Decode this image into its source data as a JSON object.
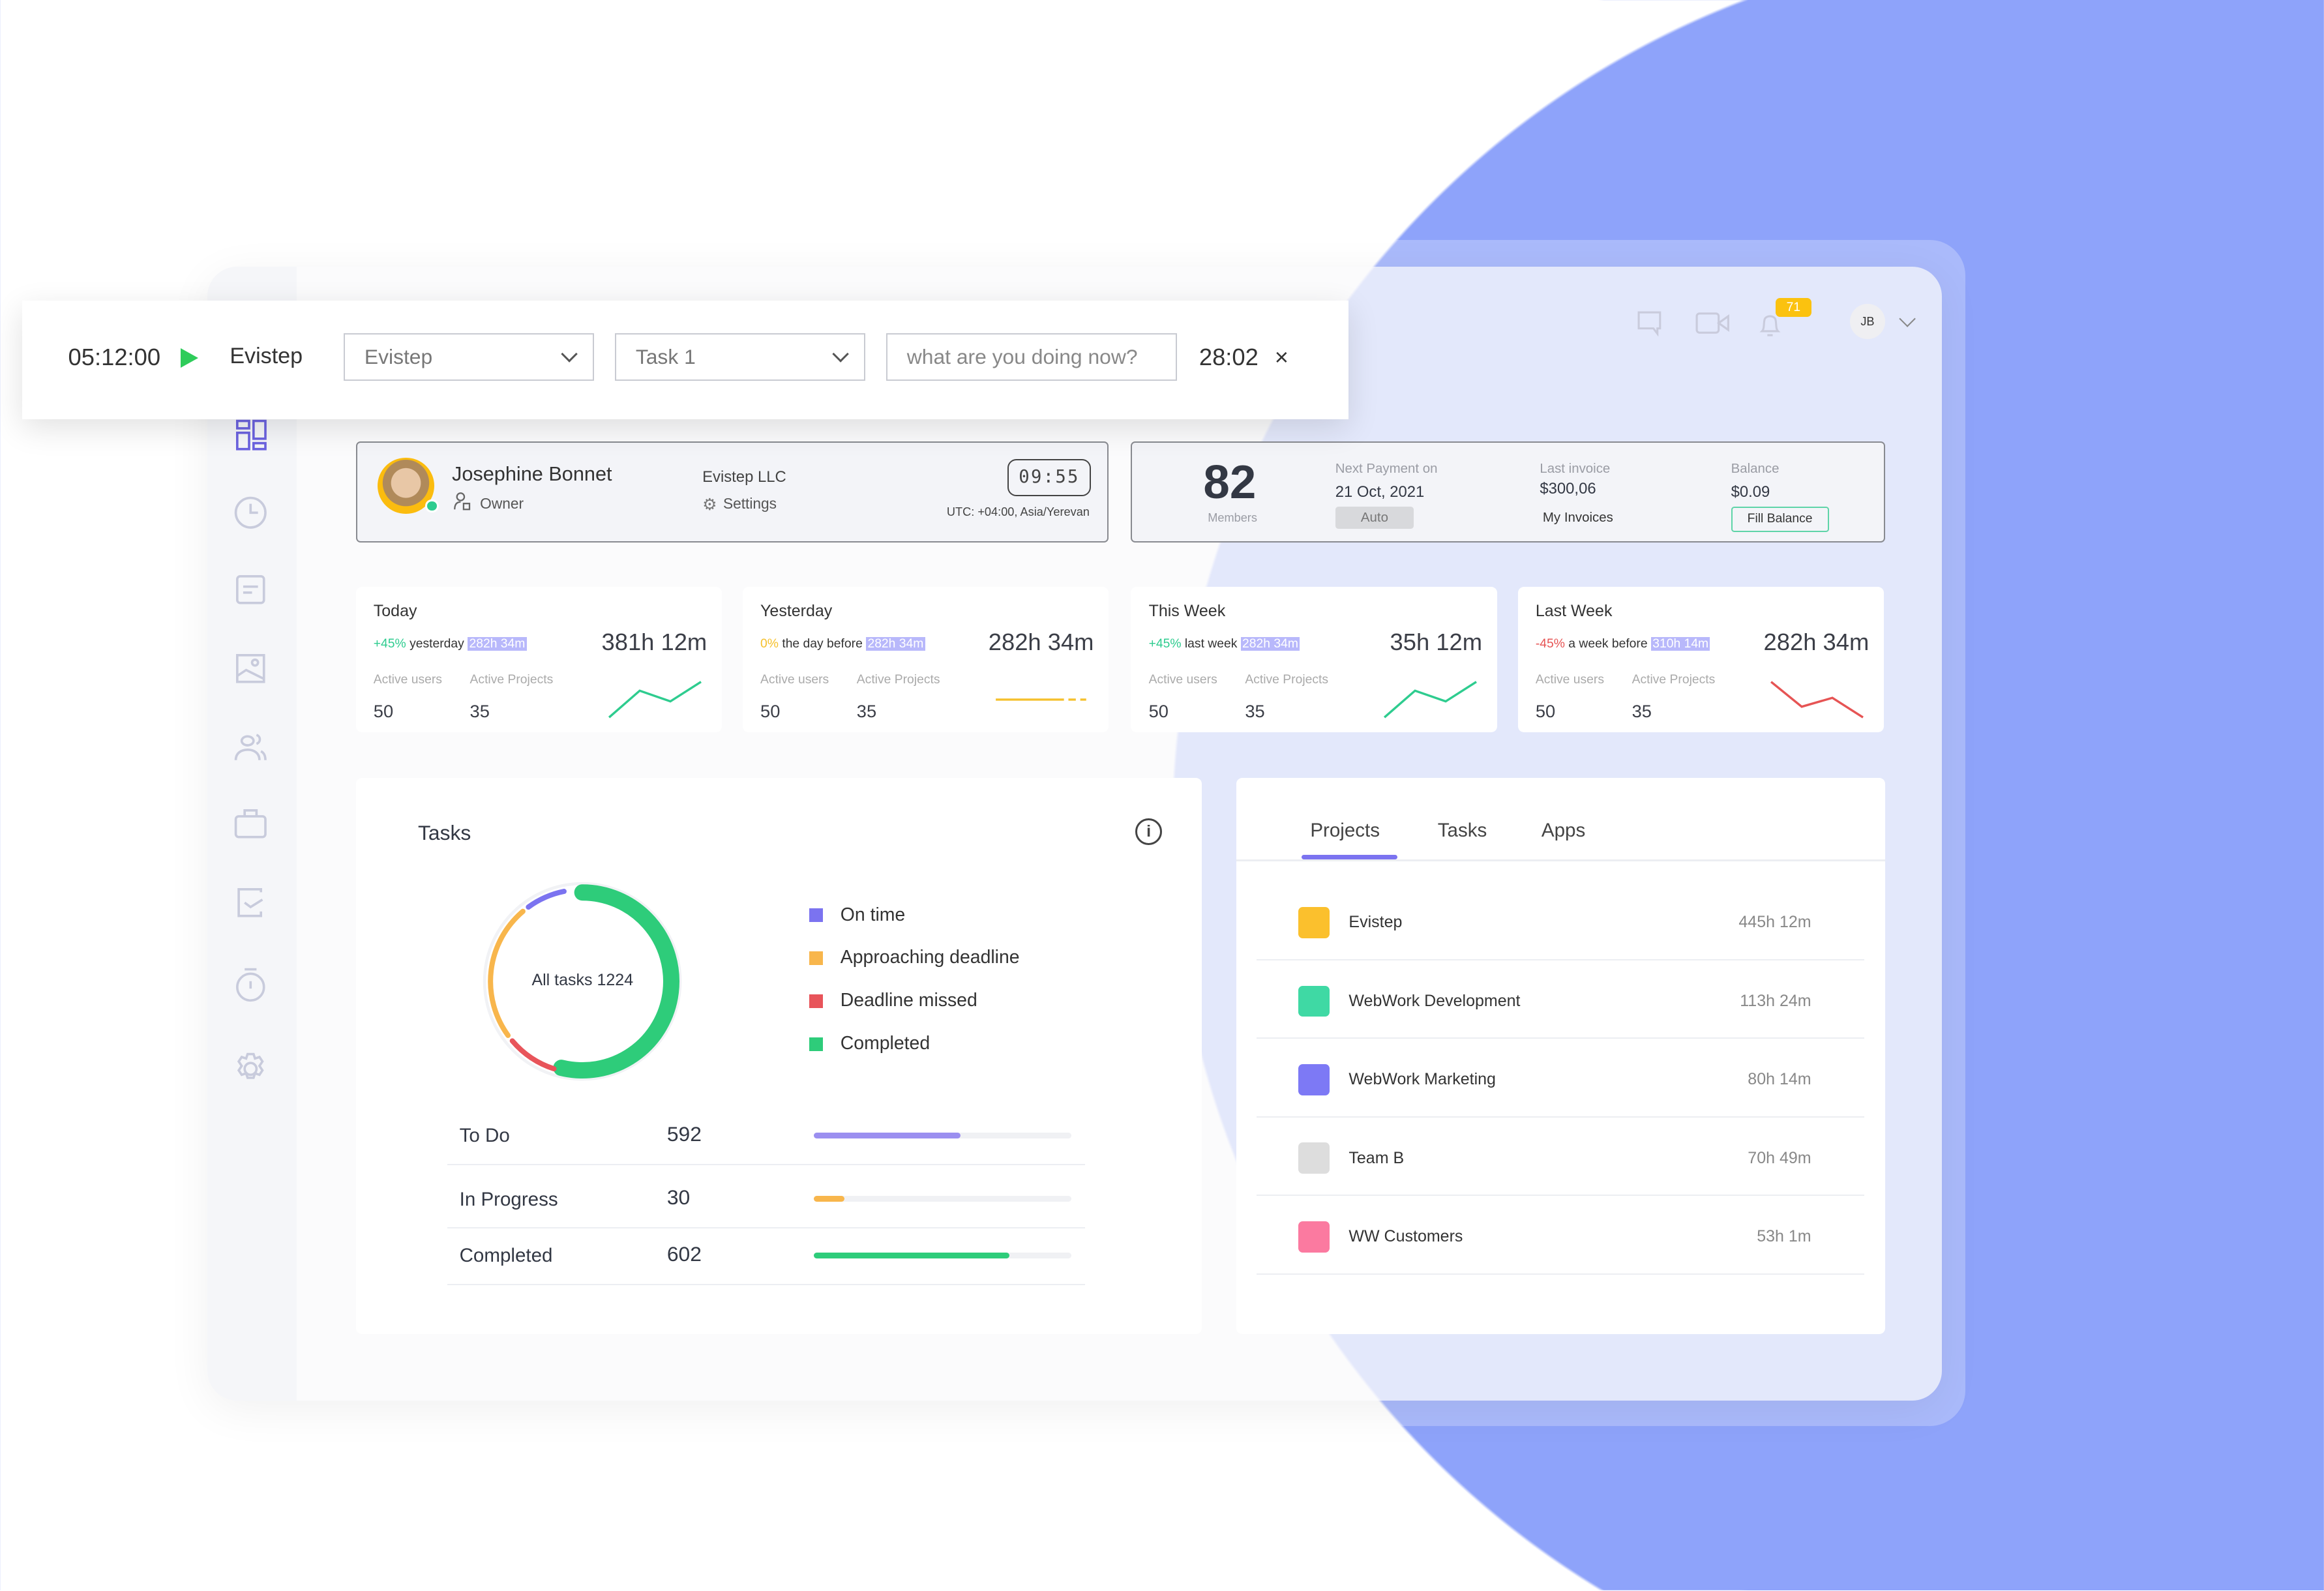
{
  "timer_bar": {
    "elapsed": "05:12:00",
    "project_label": "Evistep",
    "project_select": "Evistep",
    "task_select": "Task 1",
    "activity_placeholder": "what are you doing now?",
    "task_time": "28:02"
  },
  "header": {
    "notifications_count": "71",
    "user_initials": "JB"
  },
  "sidebar": {
    "items": [
      "dashboard-icon",
      "clock-icon",
      "document-icon",
      "image-icon",
      "users-icon",
      "briefcase-icon",
      "task-check-icon",
      "stopwatch-icon",
      "gear-icon"
    ],
    "active_color": "#6c63e0"
  },
  "profile": {
    "name": "Josephine Bonnet",
    "role": "Owner",
    "company": "Evistep LLC",
    "settings": "Settings",
    "clock": "09:55",
    "timezone": "UTC: +04:00, Asia/Yerevan"
  },
  "billing": {
    "members_count": "82",
    "members_label": "Members",
    "next_payment_label": "Next Payment on",
    "next_payment_date": "21 Oct, 2021",
    "auto_label": "Auto",
    "last_invoice_label": "Last invoice",
    "last_invoice_value": "$300,06",
    "my_invoices": "My Invoices",
    "balance_label": "Balance",
    "balance_value": "$0.09",
    "fill_balance": "Fill Balance"
  },
  "stats": [
    {
      "title": "Today",
      "change": "+45%",
      "change_color": "#2ecc8f",
      "compare": "yesterday",
      "compare_value": "282h 34m",
      "total": "381h 12m",
      "active_users_label": "Active users",
      "active_projects_label": "Active Projects",
      "active_users": "50",
      "active_projects": "35",
      "trend": [
        0,
        0.75,
        0.45,
        1
      ],
      "trend_color": "#2ecc8f"
    },
    {
      "title": "Yesterday",
      "change": "0%",
      "change_color": "#f5c02c",
      "compare": "the day before",
      "compare_value": "282h 34m",
      "total": "282h 34m",
      "active_users_label": "Active users",
      "active_projects_label": "Active Projects",
      "active_users": "50",
      "active_projects": "35",
      "trend": [
        0.5,
        0.5,
        0.5,
        0.5
      ],
      "trend_color": "#f5c02c"
    },
    {
      "title": "This Week",
      "change": "+45%",
      "change_color": "#2ecc8f",
      "compare": "last week",
      "compare_value": "282h 34m",
      "total": "35h 12m",
      "active_users_label": "Active users",
      "active_projects_label": "Active Projects",
      "active_users": "50",
      "active_projects": "35",
      "trend": [
        0,
        0.75,
        0.45,
        1
      ],
      "trend_color": "#2ecc8f"
    },
    {
      "title": "Last Week",
      "change": "-45%",
      "change_color": "#e65454",
      "compare": "a week before",
      "compare_value": "310h 14m",
      "total": "282h 34m",
      "active_users_label": "Active users",
      "active_projects_label": "Active Projects",
      "active_users": "50",
      "active_projects": "35",
      "trend": [
        1,
        0.3,
        0.55,
        0
      ],
      "trend_color": "#e65454"
    }
  ],
  "tasks": {
    "title": "Tasks",
    "donut_label": "All tasks 1224",
    "legend": [
      {
        "label": "On time",
        "color": "#7b73f0",
        "fraction": 0.08
      },
      {
        "label": "Approaching deadline",
        "color": "#f8b64c",
        "fraction": 0.25
      },
      {
        "label": "Deadline missed",
        "color": "#e8545a",
        "fraction": 0.1
      },
      {
        "label": "Completed",
        "color": "#2ecc7a",
        "fraction": 0.55
      }
    ],
    "rows": [
      {
        "label": "To Do",
        "value": "592",
        "progress": 0.57,
        "color": "#9b8ff0"
      },
      {
        "label": "In Progress",
        "value": "30",
        "progress": 0.12,
        "color": "#f8b64c"
      },
      {
        "label": "Completed",
        "value": "602",
        "progress": 0.76,
        "color": "#2ecc7a"
      }
    ]
  },
  "projects_panel": {
    "tabs": [
      "Projects",
      "Tasks",
      "Apps"
    ],
    "active_tab": "Projects",
    "items": [
      {
        "name": "Evistep",
        "time": "445h 12m",
        "color": "#fbc02d"
      },
      {
        "name": "WebWork Development",
        "time": "113h 24m",
        "color": "#3fd9a4"
      },
      {
        "name": "WebWork Marketing",
        "time": "80h 14m",
        "color": "#7d79f5"
      },
      {
        "name": "Team B",
        "time": "70h 49m",
        "color": "#dddddd"
      },
      {
        "name": "WW Customers",
        "time": "53h 1m",
        "color": "#fb7aa0"
      }
    ]
  }
}
